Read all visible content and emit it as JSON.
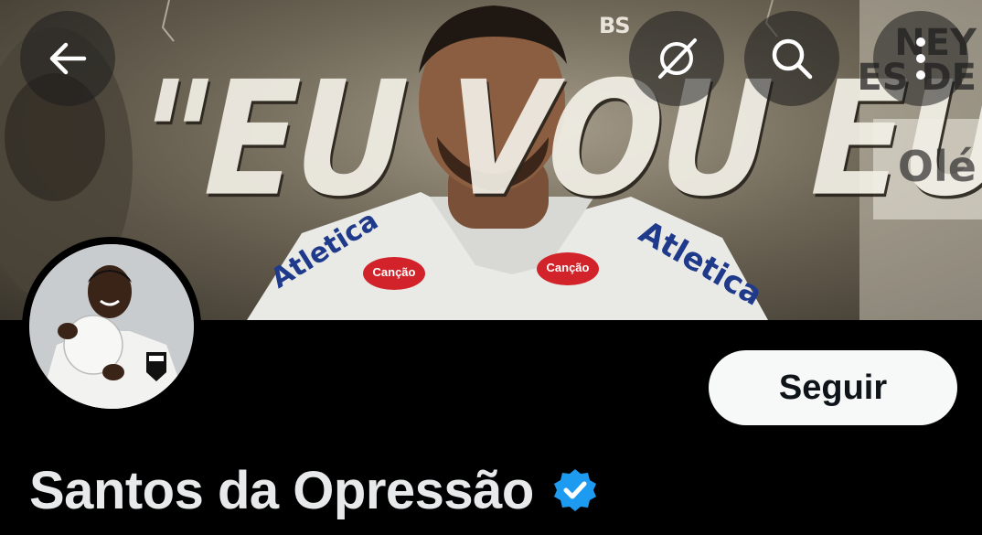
{
  "header": {
    "back_icon": "arrow-left-icon",
    "translate_icon": "no-translate-icon",
    "search_icon": "search-icon",
    "more_icon": "more-vertical-icon"
  },
  "banner": {
    "headline": "\"EU VOU   EU VOLTO\"",
    "corner_logo": "BS",
    "corner_text_1": "NEY",
    "corner_text_2": "ES DE",
    "corner_text_3": "Olé",
    "jersey_badge": "Canção"
  },
  "profile": {
    "display_name": "Santos da Opressão",
    "verified_icon": "verified-badge-icon",
    "follow_label": "Seguir"
  },
  "colors": {
    "background": "#000000",
    "name_text": "#e7e9ea",
    "follow_bg": "#f7f9f9",
    "follow_text": "#0f1419",
    "verified_blue": "#1d9bf0"
  }
}
